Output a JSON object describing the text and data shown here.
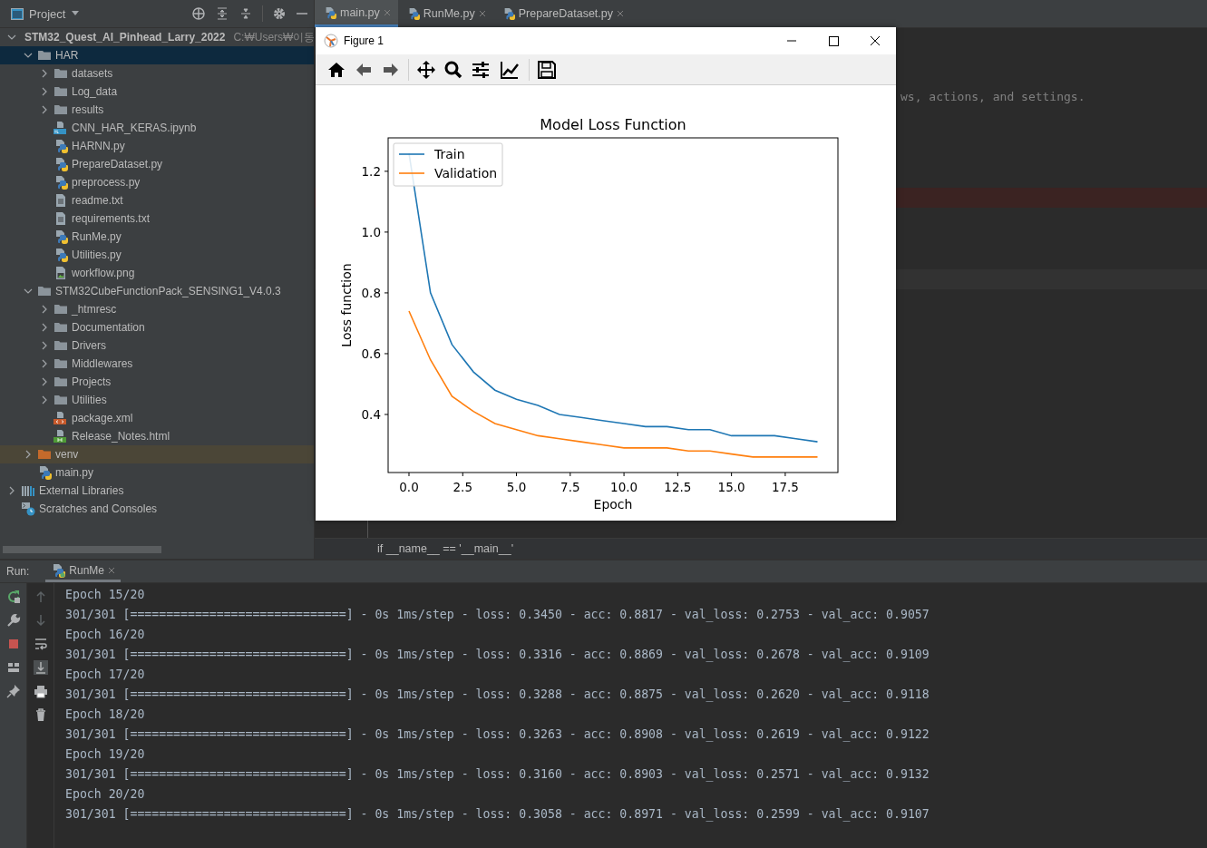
{
  "sidebar": {
    "title": "Project",
    "tree": [
      {
        "kind": "folder",
        "label": "STM32_Quest_AI_Pinhead_Larry_2022",
        "path": "C:₩Users₩이동",
        "expanded": true,
        "selected": false,
        "children": [
          {
            "kind": "folder",
            "label": "HAR",
            "expanded": true,
            "selected": true,
            "children": [
              {
                "kind": "folder",
                "label": "datasets",
                "expanded": false,
                "selected": false
              },
              {
                "kind": "folder",
                "label": "Log_data",
                "expanded": false,
                "selected": false
              },
              {
                "kind": "folder",
                "label": "results",
                "expanded": false,
                "selected": false
              },
              {
                "kind": "notebook",
                "label": "CNN_HAR_KERAS.ipynb",
                "selected": false
              },
              {
                "kind": "python",
                "label": "HARNN.py",
                "selected": false
              },
              {
                "kind": "python",
                "label": "PrepareDataset.py",
                "selected": false
              },
              {
                "kind": "python",
                "label": "preprocess.py",
                "selected": false
              },
              {
                "kind": "text",
                "label": "readme.txt",
                "selected": false
              },
              {
                "kind": "text",
                "label": "requirements.txt",
                "selected": false
              },
              {
                "kind": "python",
                "label": "RunMe.py",
                "selected": false
              },
              {
                "kind": "python",
                "label": "Utilities.py",
                "selected": false
              },
              {
                "kind": "image",
                "label": "workflow.png",
                "selected": false
              }
            ]
          },
          {
            "kind": "folder",
            "label": "STM32CubeFunctionPack_SENSING1_V4.0.3",
            "expanded": true,
            "selected": false,
            "children": [
              {
                "kind": "folder",
                "label": "_htmresc",
                "expanded": false,
                "selected": false
              },
              {
                "kind": "folder",
                "label": "Documentation",
                "expanded": false,
                "selected": false
              },
              {
                "kind": "folder",
                "label": "Drivers",
                "expanded": false,
                "selected": false
              },
              {
                "kind": "folder",
                "label": "Middlewares",
                "expanded": false,
                "selected": false
              },
              {
                "kind": "folder",
                "label": "Projects",
                "expanded": false,
                "selected": false
              },
              {
                "kind": "folder",
                "label": "Utilities",
                "expanded": false,
                "selected": false
              },
              {
                "kind": "xml",
                "label": "package.xml",
                "selected": false
              },
              {
                "kind": "html",
                "label": "Release_Notes.html",
                "selected": false
              }
            ]
          },
          {
            "kind": "excluded",
            "label": "venv",
            "expanded": false,
            "selected": false
          },
          {
            "kind": "python",
            "label": "main.py",
            "selected": false
          }
        ]
      },
      {
        "kind": "libraries",
        "label": "External Libraries",
        "expanded": false,
        "selected": false
      },
      {
        "kind": "scratches",
        "label": "Scratches and Consoles",
        "selected": false
      }
    ]
  },
  "editor": {
    "tabs": [
      {
        "label": "main.py",
        "selected": true
      },
      {
        "label": "RunMe.py",
        "selected": false
      },
      {
        "label": "PrepareDataset.py",
        "selected": false
      }
    ],
    "comment_fragment": "ws, actions, and settings.",
    "marked_lines": [
      {
        "kind": "breakpoint"
      },
      {
        "kind": "current"
      }
    ],
    "breadcrumb": "if __name__ == '__main__'"
  },
  "figure": {
    "title": "Figure 1",
    "chart_data": {
      "type": "line",
      "title": "Model Loss Function",
      "xlabel": "Epoch",
      "ylabel": "Loss function",
      "x": [
        0,
        1,
        2,
        3,
        4,
        5,
        6,
        7,
        8,
        9,
        10,
        11,
        12,
        13,
        14,
        15,
        16,
        17,
        18,
        19
      ],
      "series": [
        {
          "name": "Train",
          "color": "#1f77b4",
          "values": [
            1.26,
            0.8,
            0.63,
            0.54,
            0.48,
            0.45,
            0.43,
            0.4,
            0.39,
            0.38,
            0.37,
            0.36,
            0.36,
            0.35,
            0.35,
            0.33,
            0.33,
            0.33,
            0.32,
            0.31
          ]
        },
        {
          "name": "Validation",
          "color": "#ff7f0e",
          "values": [
            0.74,
            0.58,
            0.46,
            0.41,
            0.37,
            0.35,
            0.33,
            0.32,
            0.31,
            0.3,
            0.29,
            0.29,
            0.29,
            0.28,
            0.28,
            0.27,
            0.26,
            0.26,
            0.26,
            0.26
          ]
        }
      ],
      "legend": "upper left",
      "xlim": [
        -0.97,
        19.95
      ],
      "ylim": [
        0.209,
        1.31
      ],
      "xticks": [
        {
          "value": 0,
          "label": "0.0"
        },
        {
          "value": 2.5,
          "label": "2.5"
        },
        {
          "value": 5,
          "label": "5.0"
        },
        {
          "value": 7.5,
          "label": "7.5"
        },
        {
          "value": 10,
          "label": "10.0"
        },
        {
          "value": 12.5,
          "label": "12.5"
        },
        {
          "value": 15,
          "label": "15.0"
        },
        {
          "value": 17.5,
          "label": "17.5"
        }
      ],
      "yticks": [
        {
          "value": 0.4,
          "label": "0.4"
        },
        {
          "value": 0.6,
          "label": "0.6"
        },
        {
          "value": 0.8,
          "label": "0.8"
        },
        {
          "value": 1.0,
          "label": "1.0"
        },
        {
          "value": 1.2,
          "label": "1.2"
        }
      ]
    }
  },
  "run": {
    "label": "Run:",
    "tabs": [
      {
        "label": "RunMe",
        "selected": true
      }
    ],
    "console": [
      "Epoch 15/20",
      "301/301 [==============================] - 0s 1ms/step - loss: 0.3450 - acc: 0.8817 - val_loss: 0.2753 - val_acc: 0.9057",
      "Epoch 16/20",
      "301/301 [==============================] - 0s 1ms/step - loss: 0.3316 - acc: 0.8869 - val_loss: 0.2678 - val_acc: 0.9109",
      "Epoch 17/20",
      "301/301 [==============================] - 0s 1ms/step - loss: 0.3288 - acc: 0.8875 - val_loss: 0.2620 - val_acc: 0.9118",
      "Epoch 18/20",
      "301/301 [==============================] - 0s 1ms/step - loss: 0.3263 - acc: 0.8908 - val_loss: 0.2619 - val_acc: 0.9122",
      "Epoch 19/20",
      "301/301 [==============================] - 0s 1ms/step - loss: 0.3160 - acc: 0.8903 - val_loss: 0.2571 - val_acc: 0.9132",
      "Epoch 20/20",
      "301/301 [==============================] - 0s 1ms/step - loss: 0.3058 - acc: 0.8971 - val_loss: 0.2599 - val_acc: 0.9107"
    ]
  }
}
